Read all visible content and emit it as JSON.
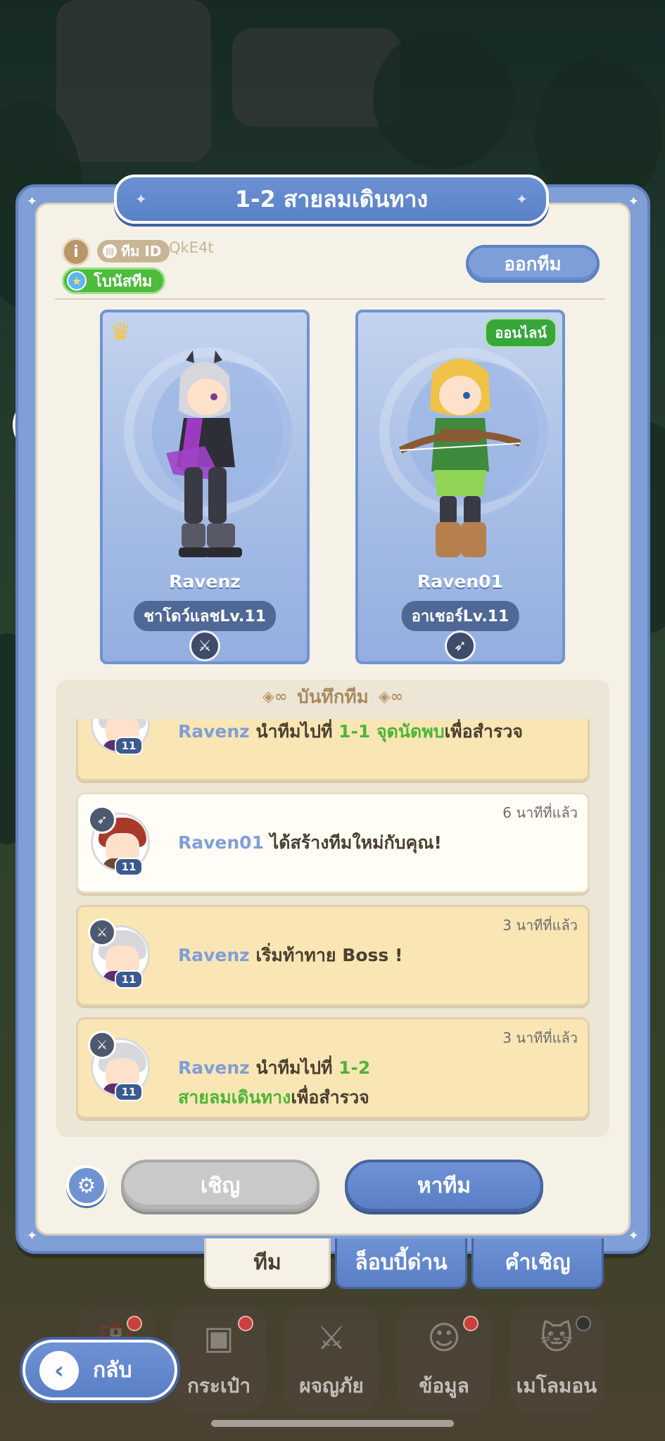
{
  "title": "1-2 สายลมเดินทาง",
  "header": {
    "team_id_label": "ทีม ID",
    "team_code": "QkE4t",
    "bonus_label": "โบนัสทีม",
    "leave_button": "ออกทีม"
  },
  "members": [
    {
      "name": "Ravenz",
      "class_level": "ชาโดว์แลชLv.11",
      "is_leader": true,
      "status": ""
    },
    {
      "name": "Raven01",
      "class_level": "อาเชอร์Lv.11",
      "is_leader": false,
      "status": "ออนไลน์"
    }
  ],
  "log": {
    "title": "บันทึกทีม",
    "entries": [
      {
        "time": "",
        "actor": "Ravenz",
        "text_a": " นำทีมไปที่ ",
        "highlight": "1-1 จุดนัดพบ",
        "text_b": "เพื่อสำรวจ",
        "level": "11"
      },
      {
        "time": "6 นาทีที่แล้ว",
        "actor": "Raven01",
        "text_a": " ได้สร้างทีมใหม่กับคุณ!",
        "level": "11"
      },
      {
        "time": "3 นาทีที่แล้ว",
        "actor": "Ravenz",
        "text_a": " เริ่มท้าทาย Boss !",
        "level": "11"
      },
      {
        "time": "3 นาทีที่แล้ว",
        "actor": "Ravenz",
        "text_a": " นำทีมไปที่ ",
        "highlight_line1": "1-2",
        "highlight_line2": "สายลมเดินทาง",
        "text_b": "เพื่อสำรวจ",
        "level": "11"
      }
    ]
  },
  "actions": {
    "invite": "เชิญ",
    "find_team": "หาทีม"
  },
  "tabs": [
    "ทีม",
    "ล็อบบี้ด่าน",
    "คำเชิญ"
  ],
  "bottom_nav": {
    "back": "กลับ",
    "items": [
      "กระเป๋า",
      "ผจญภัย",
      "ข้อมูล",
      "เมโลมอน"
    ]
  }
}
